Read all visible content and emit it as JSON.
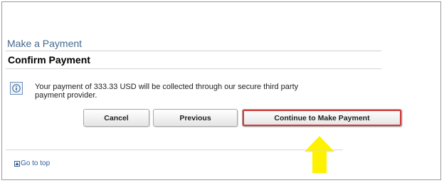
{
  "page": {
    "heading": "Make a Payment",
    "section_title": "Confirm Payment"
  },
  "message": {
    "text": "Your payment of 333.33 USD will be collected through our secure third party payment provider.",
    "icon": "info-icon"
  },
  "buttons": {
    "cancel": "Cancel",
    "previous": "Previous",
    "continue": "Continue to Make Payment"
  },
  "footer": {
    "go_to_top": "Go to top",
    "icon": "up-arrow-icon"
  },
  "colors": {
    "heading": "#44688f",
    "highlight_border": "#d23b3b",
    "arrow": "#fff200",
    "link": "#2f5d9a"
  }
}
